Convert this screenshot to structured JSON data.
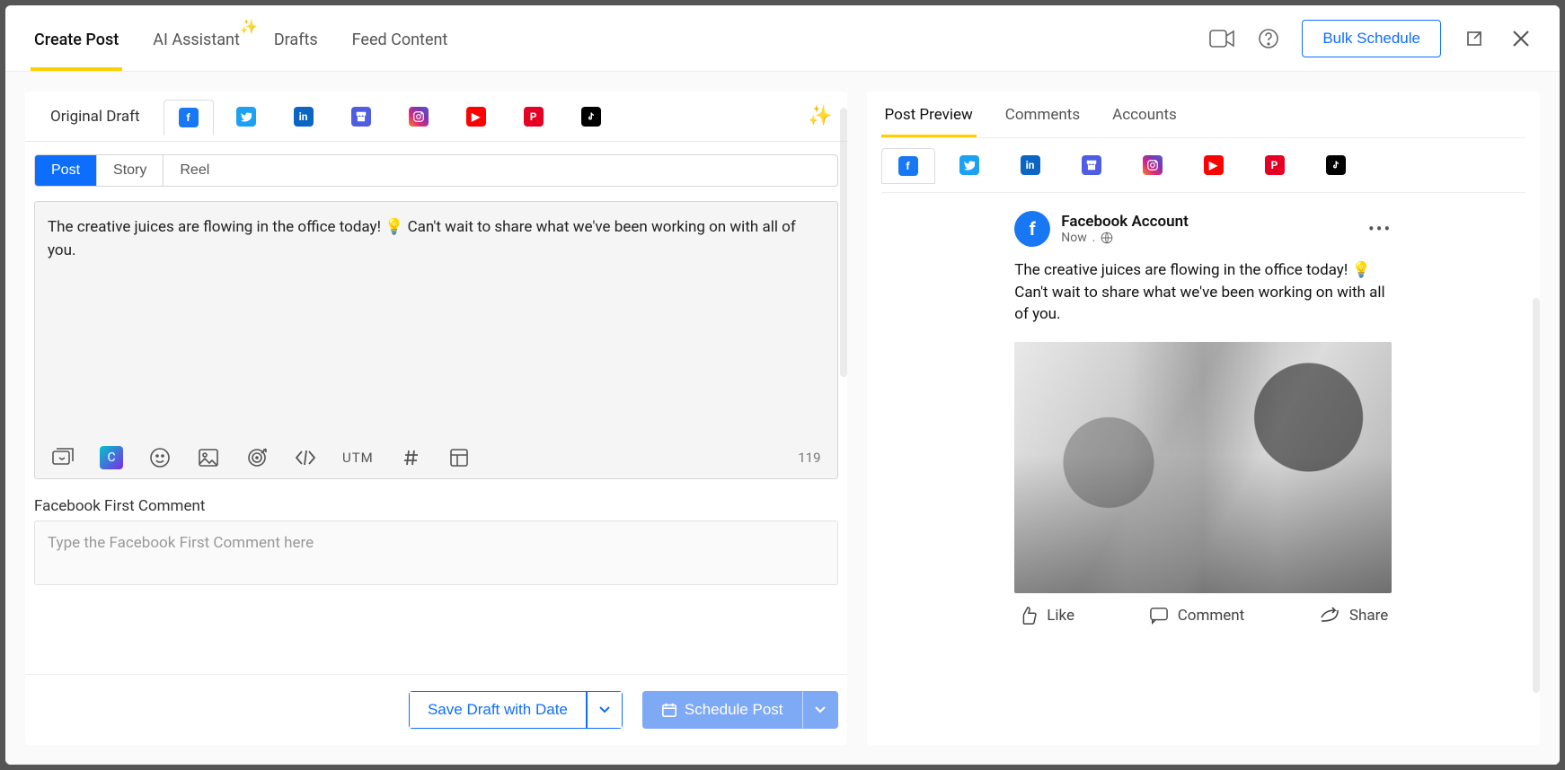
{
  "top_tabs": {
    "create_post": "Create Post",
    "ai_assistant": "AI Assistant",
    "drafts": "Drafts",
    "feed_content": "Feed Content"
  },
  "top_actions": {
    "bulk_schedule": "Bulk Schedule"
  },
  "left": {
    "original_draft": "Original Draft",
    "post_types": {
      "post": "Post",
      "story": "Story",
      "reel": "Reel"
    },
    "text": "The creative juices are flowing in the office today!  💡  Can't wait to share what we've been working on with all of you.",
    "utm_label": "UTM",
    "char_count": "119",
    "first_comment_label": "Facebook First Comment",
    "first_comment_placeholder": "Type the Facebook First Comment here",
    "save_draft": "Save Draft with Date",
    "schedule_post": "Schedule Post"
  },
  "right": {
    "tabs": {
      "preview": "Post Preview",
      "comments": "Comments",
      "accounts": "Accounts"
    },
    "fb": {
      "account": "Facebook Account",
      "time": "Now",
      "body": "The creative juices are flowing in the office today!  💡  Can't wait to share what we've been working on with all of you.",
      "like": "Like",
      "comment": "Comment",
      "share": "Share"
    }
  },
  "channels": [
    "facebook",
    "twitter",
    "linkedin",
    "gmb",
    "instagram",
    "youtube",
    "pinterest",
    "tiktok"
  ]
}
